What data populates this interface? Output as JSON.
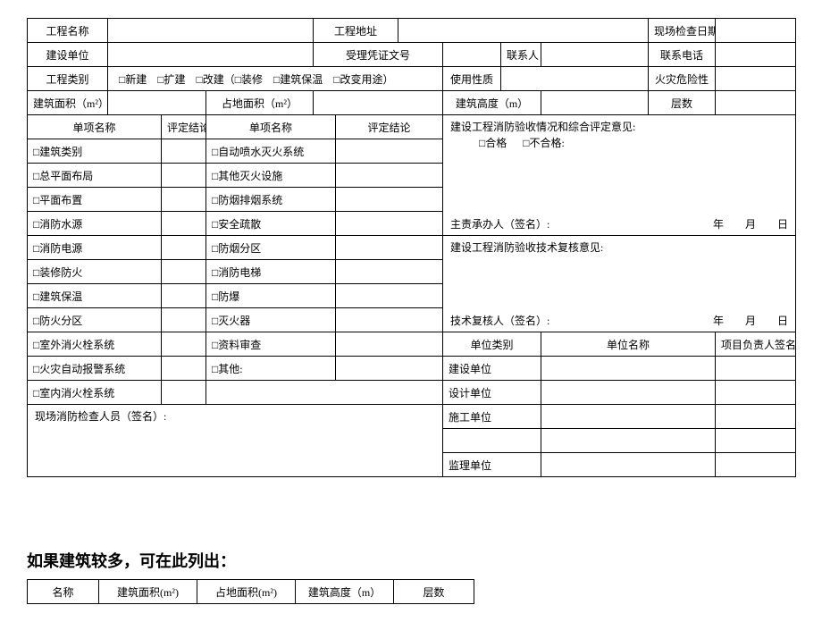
{
  "row1": {
    "c1": "工程名称",
    "c2": "工程地址",
    "c3": "现场检查日期"
  },
  "row2": {
    "c1": "建设单位",
    "c2": "受理凭证文号",
    "c3": "联系人",
    "c4": "联系电话"
  },
  "row3": {
    "c1": "工程类别",
    "opts": "□新建　□扩建　□改建（□装修　□建筑保温　□改变用途）",
    "c2": "使用性质",
    "c3": "火灾危险性"
  },
  "row4": {
    "c1": "建筑面积（m²）",
    "c2": "占地面积（m²）",
    "c3": "建筑高度（m）",
    "c4": "层数"
  },
  "header_items": {
    "c1": "单项名称",
    "c2": "评定结论",
    "c3": "单项名称",
    "c4": "评定结论"
  },
  "items_left": [
    "□建筑类别",
    "□总平面布局",
    "□平面布置",
    "□消防水源",
    "□消防电源",
    "□装修防火",
    "□建筑保温",
    "□防火分区",
    "□室外消火栓系统",
    "□火灾自动报警系统",
    "□室内消火栓系统"
  ],
  "items_right": [
    "□自动喷水灭火系统",
    "□其他灭火设施",
    "□防烟排烟系统",
    "□安全疏散",
    "□防烟分区",
    "□消防电梯",
    "□防爆",
    "□灭火器",
    "□资料审查",
    "□其他:"
  ],
  "opinion1": {
    "title": "建设工程消防验收情况和综合评定意见:",
    "pass": "□合格",
    "fail": "□不合格:",
    "signer": "主责承办人（签名）:",
    "date": "年　　月　　日"
  },
  "opinion2": {
    "title": "建设工程消防验收技术复核意见:",
    "signer": "技术复核人（签名）:",
    "date": "年　　月　　日"
  },
  "unit_header": {
    "c1": "单位类别",
    "c2": "单位名称",
    "c3": "项目负责人签名"
  },
  "units": [
    "建设单位",
    "设计单位",
    "施工单位",
    "",
    "监理单位"
  ],
  "inspector": "现场消防检查人员（签名）:",
  "note": "如果建筑较多，可在此列出：",
  "bottom_header": {
    "c1": "名称",
    "c2": "建筑面积(m²)",
    "c3": "占地面积(m²)",
    "c4": "建筑高度（m）",
    "c5": "层数"
  }
}
